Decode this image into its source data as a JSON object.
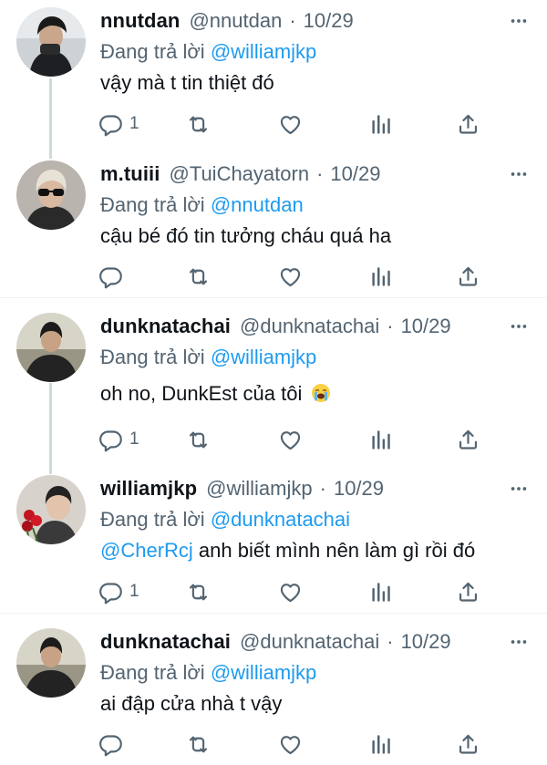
{
  "reply_prefix": "Đang trả lời",
  "tweets": [
    {
      "name": "nnutdan",
      "handle": "@nnutdan",
      "separator": "·",
      "time": "10/29",
      "reply_to": "@williamjkp",
      "text": "vậy mà t tin thiệt đó",
      "reply_count": "1"
    },
    {
      "name": "m.tuiii",
      "handle": "@TuiChayatorn",
      "separator": "·",
      "time": "10/29",
      "reply_to": "@nnutdan",
      "text": "cậu bé đó tin tưởng cháu quá ha",
      "reply_count": ""
    },
    {
      "name": "dunknatachai",
      "handle": "@dunknatachai",
      "separator": "·",
      "time": "10/29",
      "reply_to": "@williamjkp",
      "text": "oh no, DunkEst của tôi",
      "emoji": "loudly-crying-face-emoji",
      "reply_count": "1"
    },
    {
      "name": "williamjkp",
      "handle": "@williamjkp",
      "separator": "·",
      "time": "10/29",
      "reply_to": "@dunknatachai",
      "text_mention": "@CherRcj",
      "text": " anh biết mình nên làm gì rồi đó",
      "reply_count": "1"
    },
    {
      "name": "dunknatachai",
      "handle": "@dunknatachai",
      "separator": "·",
      "time": "10/29",
      "reply_to": "@williamjkp",
      "text": "ai đập cửa nhà t vậy",
      "reply_count": ""
    }
  ],
  "icons": [
    "reply-icon",
    "retweet-icon",
    "like-icon",
    "views-icon",
    "share-icon",
    "more-icon"
  ],
  "colors": {
    "accent": "#1d9bf0",
    "secondary_text": "#536471",
    "thread_line": "#cfd9de"
  }
}
